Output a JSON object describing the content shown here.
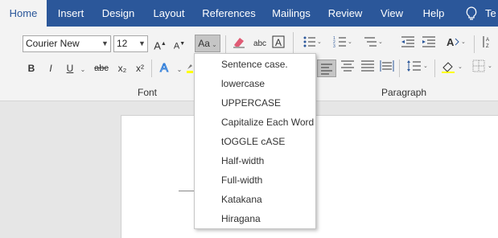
{
  "tabs": [
    {
      "label": "Home"
    },
    {
      "label": "Insert"
    },
    {
      "label": "Design"
    },
    {
      "label": "Layout"
    },
    {
      "label": "References"
    },
    {
      "label": "Mailings"
    },
    {
      "label": "Review"
    },
    {
      "label": "View"
    },
    {
      "label": "Help"
    },
    {
      "label": "Te"
    }
  ],
  "font": {
    "name": "Courier New",
    "size": "12"
  },
  "groups": {
    "font": "Font",
    "paragraph": "Paragraph"
  },
  "change_case_button": "Aa",
  "change_case_menu": {
    "items": [
      "Sentence case.",
      "lowercase",
      "UPPERCASE",
      "Capitalize Each Word",
      "tOGGLE cASE",
      "Half-width",
      "Full-width",
      "Katakana",
      "Hiragana"
    ]
  },
  "format_buttons": {
    "bold": "B",
    "italic": "I",
    "underline": "U",
    "strikethrough": "abc",
    "subscript": "x₂",
    "superscript": "x²"
  },
  "colors": {
    "tab_bar": "#2b579a",
    "ribbon": "#f3f3f3",
    "highlight": "#c5c5c5"
  }
}
